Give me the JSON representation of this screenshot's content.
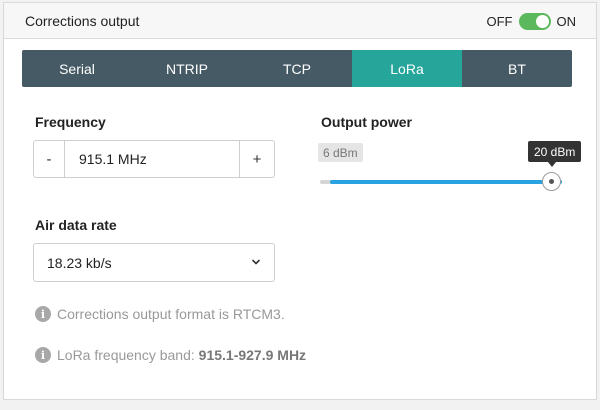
{
  "header": {
    "title": "Corrections output",
    "toggle_off_label": "OFF",
    "toggle_on_label": "ON",
    "toggle_state": "on"
  },
  "tabs": [
    {
      "label": "Serial",
      "active": false
    },
    {
      "label": "NTRIP",
      "active": false
    },
    {
      "label": "TCP",
      "active": false
    },
    {
      "label": "LoRa",
      "active": true
    },
    {
      "label": "BT",
      "active": false
    }
  ],
  "frequency": {
    "label": "Frequency",
    "minus_label": "-",
    "plus_label": "+",
    "value": "915.1 MHz"
  },
  "air_data_rate": {
    "label": "Air data rate",
    "selected": "18.23 kb/s"
  },
  "output_power": {
    "label": "Output power",
    "min_label": "6 dBm",
    "current_label": "20 dBm",
    "level_fraction": 1.0
  },
  "info": {
    "format_text": "Corrections output format is RTCM3.",
    "band_prefix": "LoRa frequency band: ",
    "band_value": "915.1-927.9 MHz"
  },
  "colors": {
    "tab_bar": "#455a64",
    "tab_active": "#26a69a",
    "toggle_on": "#5cb85c",
    "slider_fill": "#29a3e0"
  },
  "icons": {
    "info": "info-icon",
    "chevron": "chevron-down-icon"
  }
}
